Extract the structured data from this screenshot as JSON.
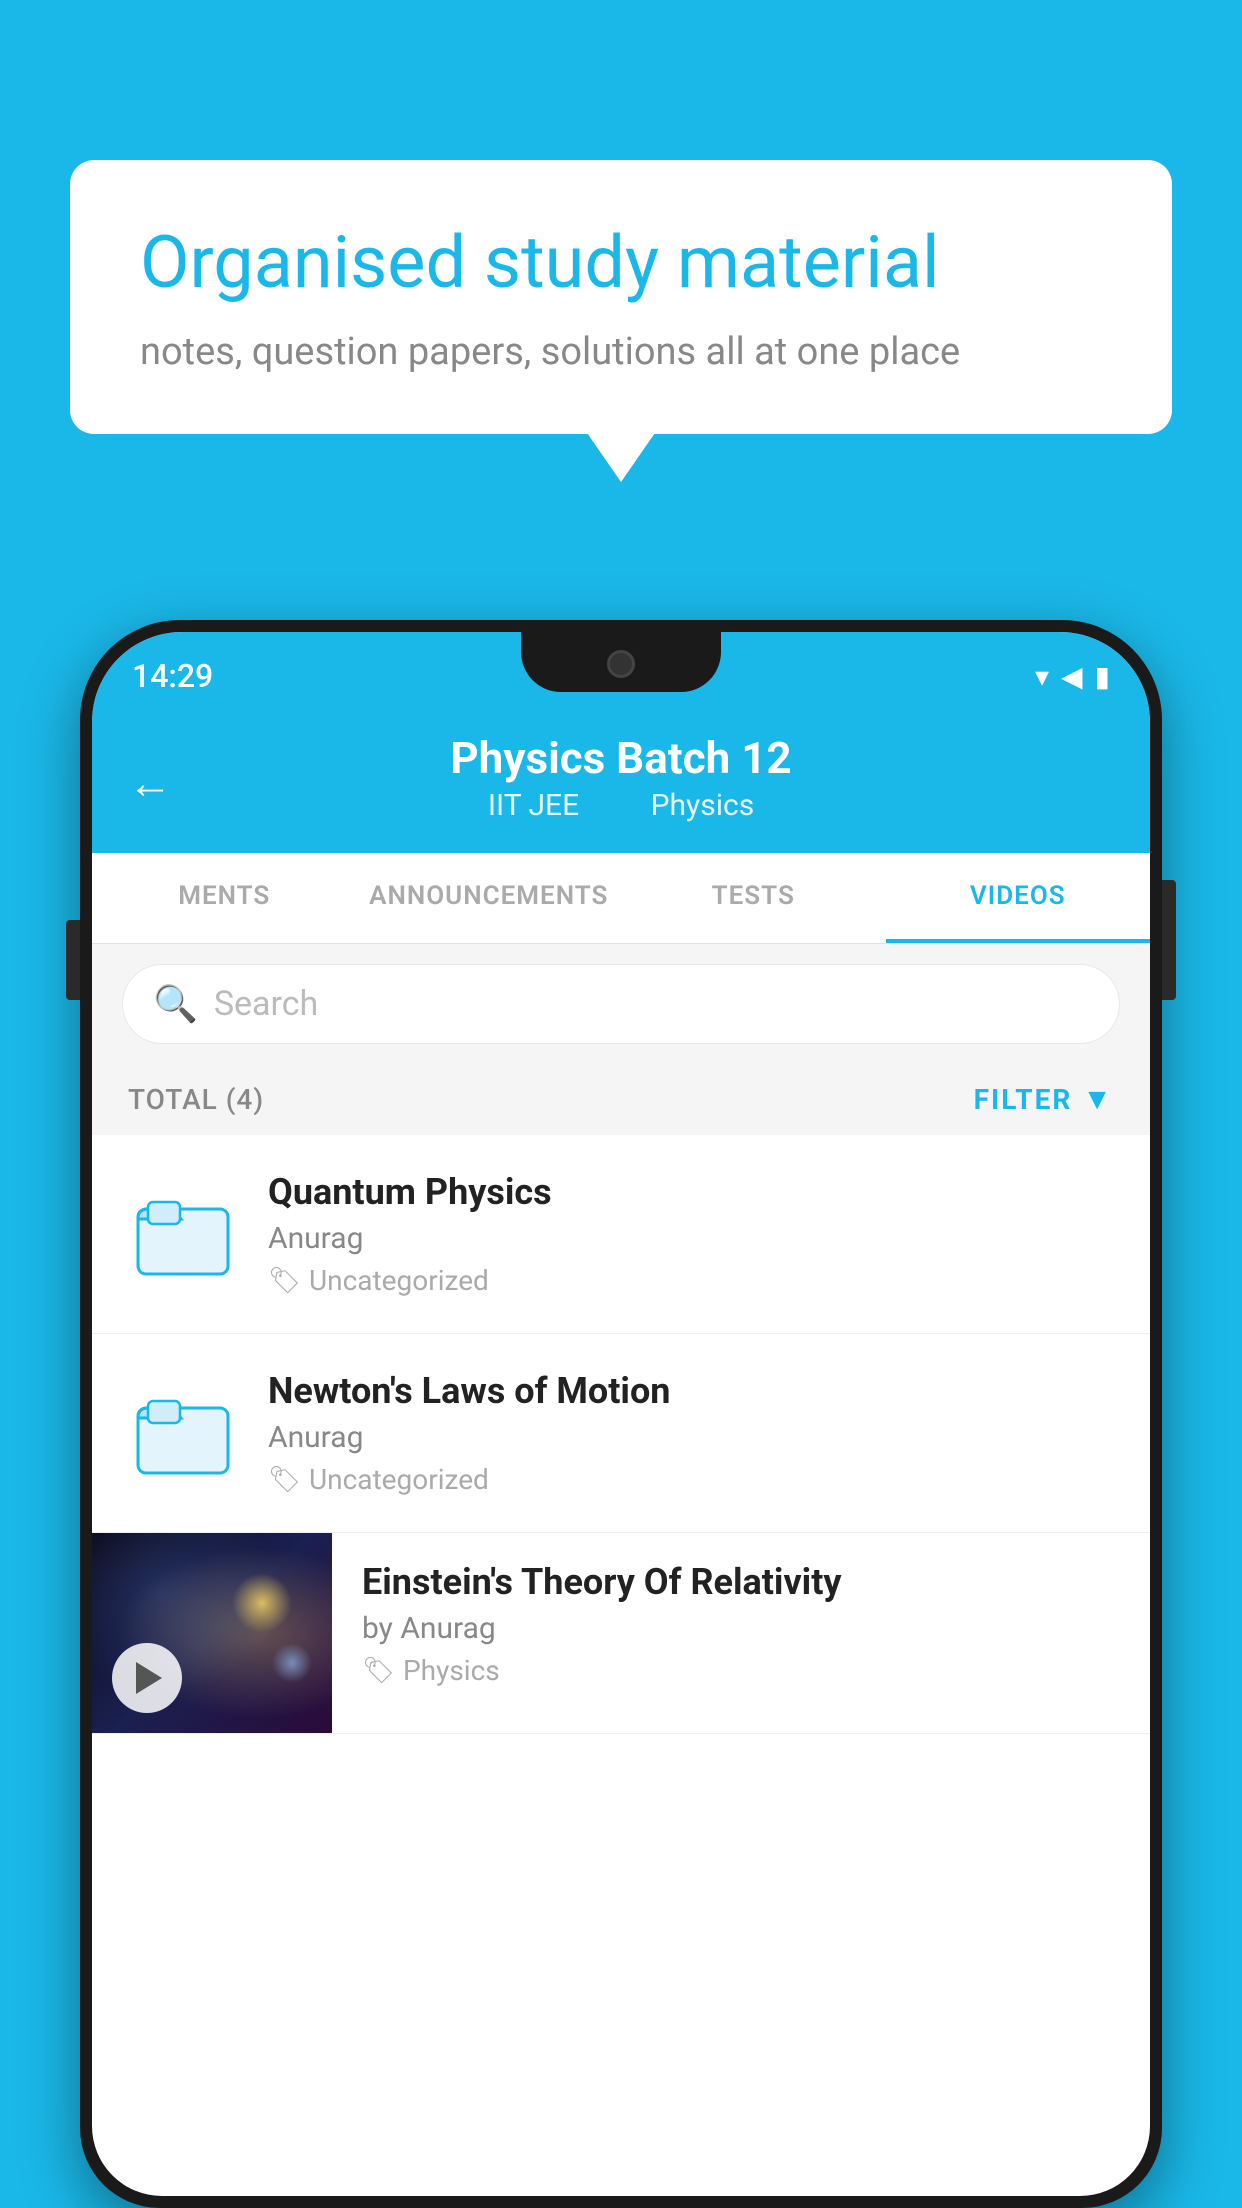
{
  "background_color": "#1ab8e8",
  "speech_bubble": {
    "title": "Organised study material",
    "subtitle": "notes, question papers, solutions all at one place"
  },
  "status_bar": {
    "time": "14:29",
    "wifi_icon": "▾",
    "signal_icon": "▲",
    "battery_icon": "▮"
  },
  "header": {
    "back_label": "←",
    "title": "Physics Batch 12",
    "tag1": "IIT JEE",
    "tag2": "Physics"
  },
  "tabs": [
    {
      "label": "MENTS",
      "active": false
    },
    {
      "label": "ANNOUNCEMENTS",
      "active": false
    },
    {
      "label": "TESTS",
      "active": false
    },
    {
      "label": "VIDEOS",
      "active": true
    }
  ],
  "search": {
    "placeholder": "Search"
  },
  "filter_bar": {
    "total_label": "TOTAL (4)",
    "filter_label": "FILTER"
  },
  "videos": [
    {
      "id": 1,
      "title": "Quantum Physics",
      "author": "Anurag",
      "tag": "Uncategorized",
      "has_thumbnail": false
    },
    {
      "id": 2,
      "title": "Newton's Laws of Motion",
      "author": "Anurag",
      "tag": "Uncategorized",
      "has_thumbnail": false
    },
    {
      "id": 3,
      "title": "Einstein's Theory Of Relativity",
      "author": "by Anurag",
      "tag": "Physics",
      "has_thumbnail": true
    }
  ]
}
